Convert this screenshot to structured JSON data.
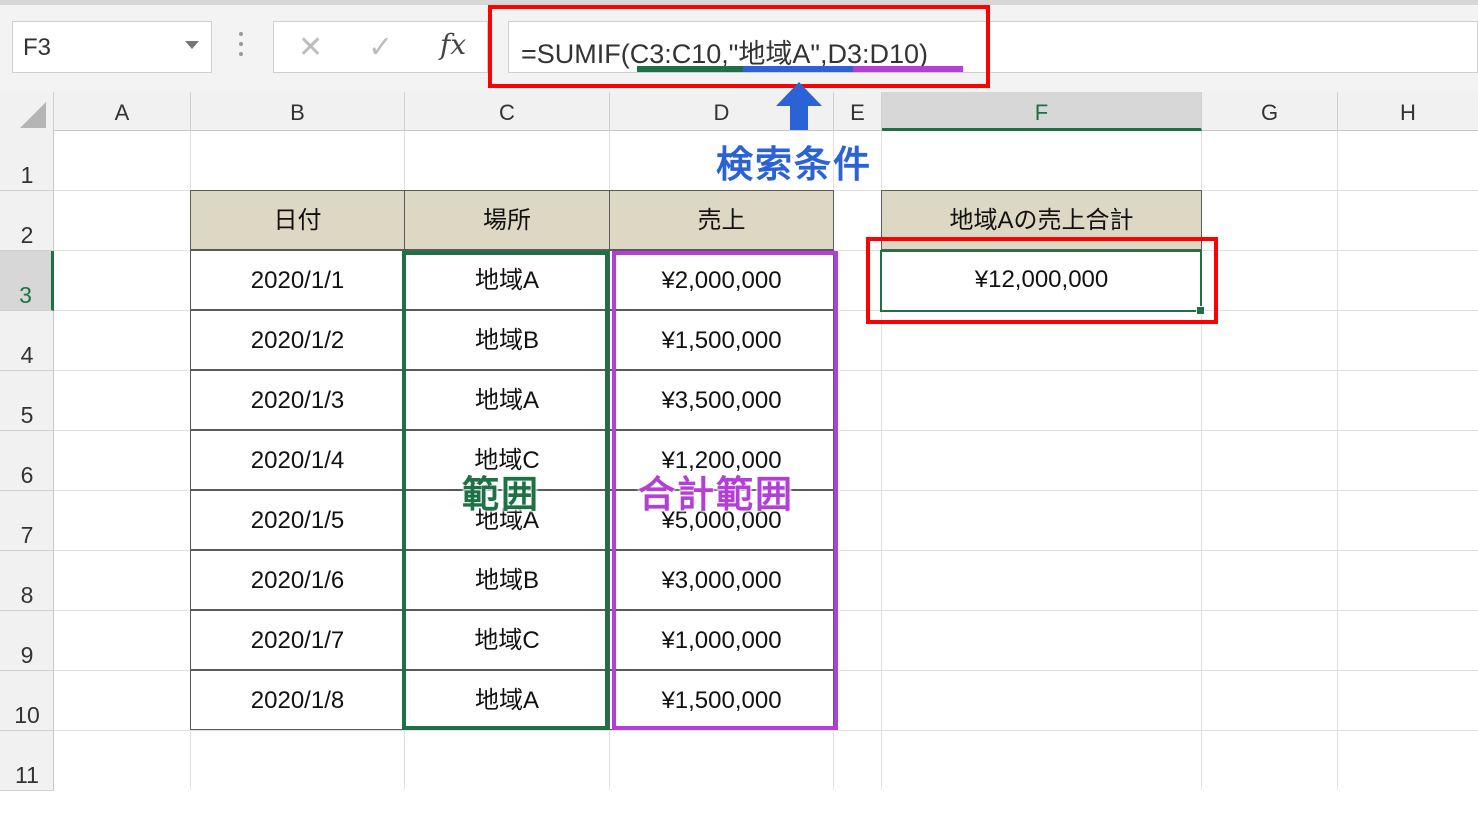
{
  "name_box": {
    "value": "F3"
  },
  "formula_bar": {
    "formula": "=SUMIF(C3:C10,\"地域A\",D3:D10)",
    "cancel_glyph": "✕",
    "enter_glyph": "✓",
    "fx_label": "fx"
  },
  "columns": [
    "A",
    "B",
    "C",
    "D",
    "E",
    "F",
    "G",
    "H"
  ],
  "active_column": "F",
  "rows": [
    "1",
    "2",
    "3",
    "4",
    "5",
    "6",
    "7",
    "8",
    "9",
    "10",
    "11"
  ],
  "active_row": "3",
  "table": {
    "headers": [
      "日付",
      "場所",
      "売上"
    ],
    "rows": [
      [
        "2020/1/1",
        "地域A",
        "¥2,000,000"
      ],
      [
        "2020/1/2",
        "地域B",
        "¥1,500,000"
      ],
      [
        "2020/1/3",
        "地域A",
        "¥3,500,000"
      ],
      [
        "2020/1/4",
        "地域C",
        "¥1,200,000"
      ],
      [
        "2020/1/5",
        "地域A",
        "¥5,000,000"
      ],
      [
        "2020/1/6",
        "地域B",
        "¥3,000,000"
      ],
      [
        "2020/1/7",
        "地域C",
        "¥1,000,000"
      ],
      [
        "2020/1/8",
        "地域A",
        "¥1,500,000"
      ]
    ]
  },
  "result": {
    "header": "地域Aの売上合計",
    "value": "¥12,000,000"
  },
  "annotations": {
    "criteria_label": "検索条件",
    "range_label": "範囲",
    "sum_range_label": "合計範囲"
  },
  "colors": {
    "range": "#1e7145",
    "criteria": "#2b63d6",
    "sum_range": "#b43fd6",
    "highlight": "#ff0000",
    "header_fill": "#ddd8c3"
  },
  "icons": {
    "cancel": "close-icon",
    "enter": "check-icon",
    "function": "fx-icon",
    "dropdown": "chevron-down-icon",
    "arrow": "arrow-up-icon"
  }
}
